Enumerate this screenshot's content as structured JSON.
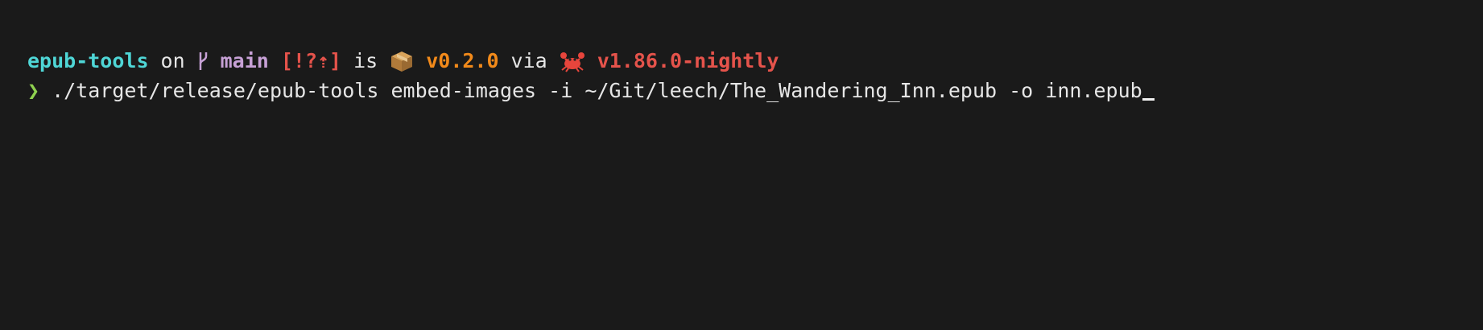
{
  "prompt": {
    "directory": "epub-tools",
    "on_word": "on",
    "branch_icon": "git-branch-icon",
    "branch": "main",
    "git_status": "[!?⇡]",
    "is_word": "is",
    "package_icon": "package-icon",
    "package_version": "v0.2.0",
    "via_word": "via",
    "rust_icon": "crab-icon",
    "rust_version": "v1.86.0-nightly"
  },
  "command_line": {
    "prompt_symbol": "❯",
    "command": "./target/release/epub-tools embed-images -i ~/Git/leech/The_Wandering_Inn.epub -o inn.epub"
  },
  "colors": {
    "background": "#1a1a1a",
    "directory": "#4fd6d6",
    "branch": "#c7a1d6",
    "git_status": "#e5534b",
    "package_version": "#f28a1a",
    "rust_version": "#e5534b",
    "prompt_symbol": "#8fd14f",
    "text": "#e6e6e6"
  }
}
